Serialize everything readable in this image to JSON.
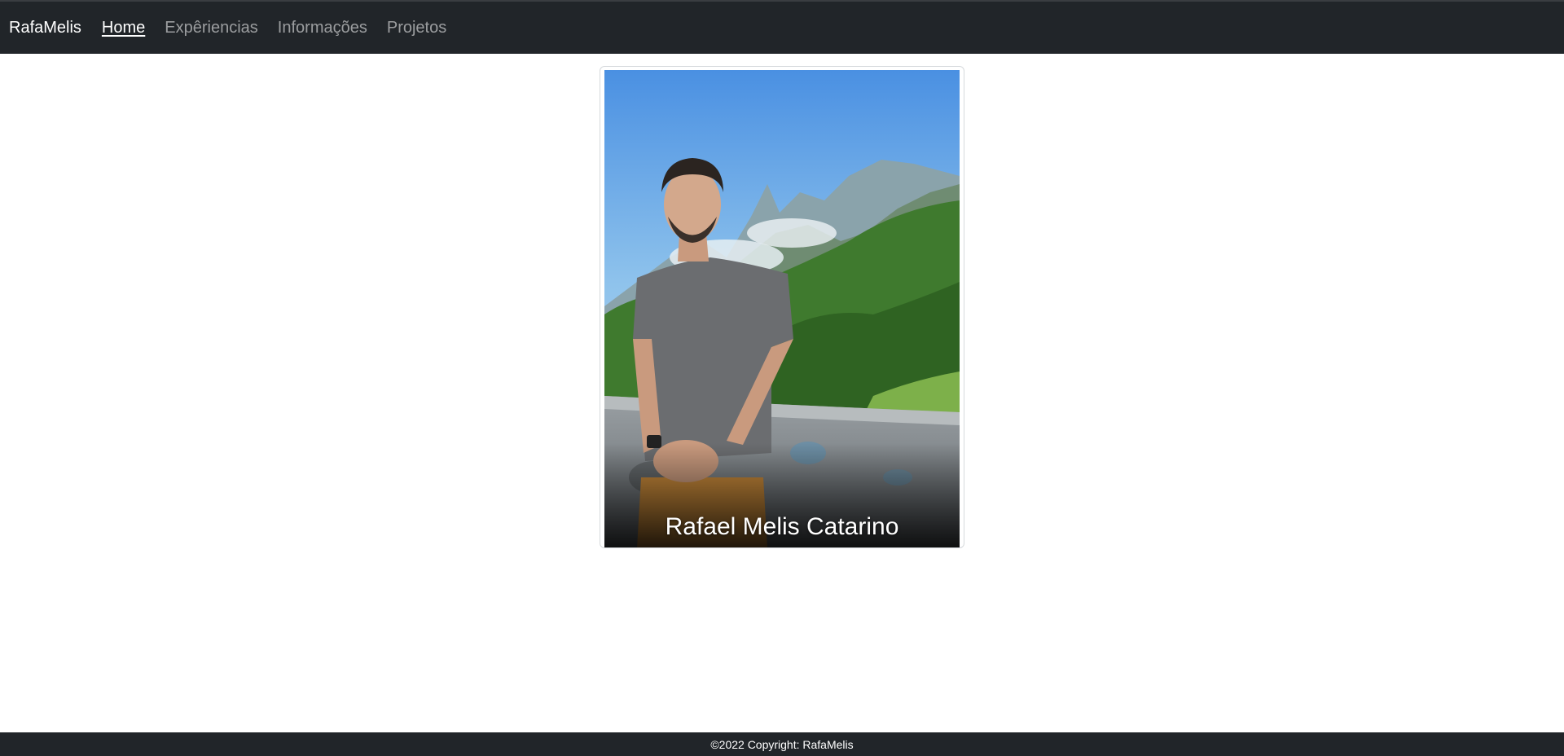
{
  "navbar": {
    "brand": "RafaMelis",
    "links": [
      {
        "label": "Home",
        "active": true
      },
      {
        "label": "Expêriencias",
        "active": false
      },
      {
        "label": "Informações",
        "active": false
      },
      {
        "label": "Projetos",
        "active": false
      }
    ]
  },
  "card": {
    "caption": "Rafael Melis Catarino",
    "image_icon": "portrait-photo"
  },
  "footer": {
    "copyright": "©2022 Copyright: RafaMelis"
  },
  "colors": {
    "navbar_bg": "#212529",
    "footer_bg": "#212529",
    "link_active": "#ffffff",
    "link_inactive": "#8c8e91"
  }
}
